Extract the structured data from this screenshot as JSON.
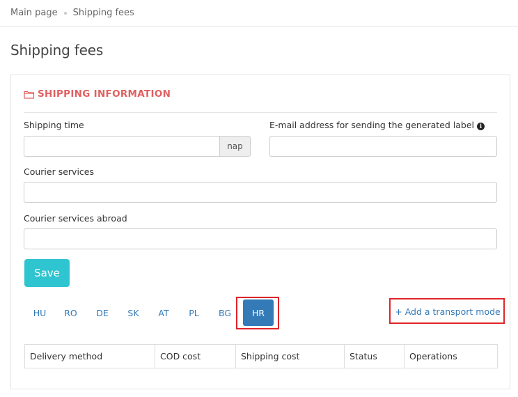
{
  "breadcrumb": {
    "items": [
      "Main page",
      "Shipping fees"
    ]
  },
  "page": {
    "title": "Shipping fees"
  },
  "panel": {
    "heading": "SHIPPING INFORMATION",
    "accent_color": "#e06060",
    "icon": "folder-icon"
  },
  "form": {
    "shipping_time_label": "Shipping time",
    "shipping_time_value": "",
    "shipping_time_unit": "nap",
    "email_label": "E-mail address for sending the generated label",
    "email_value": "",
    "courier_services_label": "Courier services",
    "courier_services_value": "",
    "courier_abroad_label": "Courier services abroad",
    "courier_abroad_value": "",
    "save_label": "Save",
    "save_color": "#2ec4d0"
  },
  "tabs": {
    "items": [
      "HU",
      "RO",
      "DE",
      "SK",
      "AT",
      "PL",
      "BG",
      "HR"
    ],
    "active": "HR",
    "active_color": "#337ab7"
  },
  "add_transport_mode_label": "+ Add a transport mode",
  "table": {
    "columns": [
      "Delivery method",
      "COD cost",
      "Shipping cost",
      "Status",
      "Operations"
    ]
  }
}
